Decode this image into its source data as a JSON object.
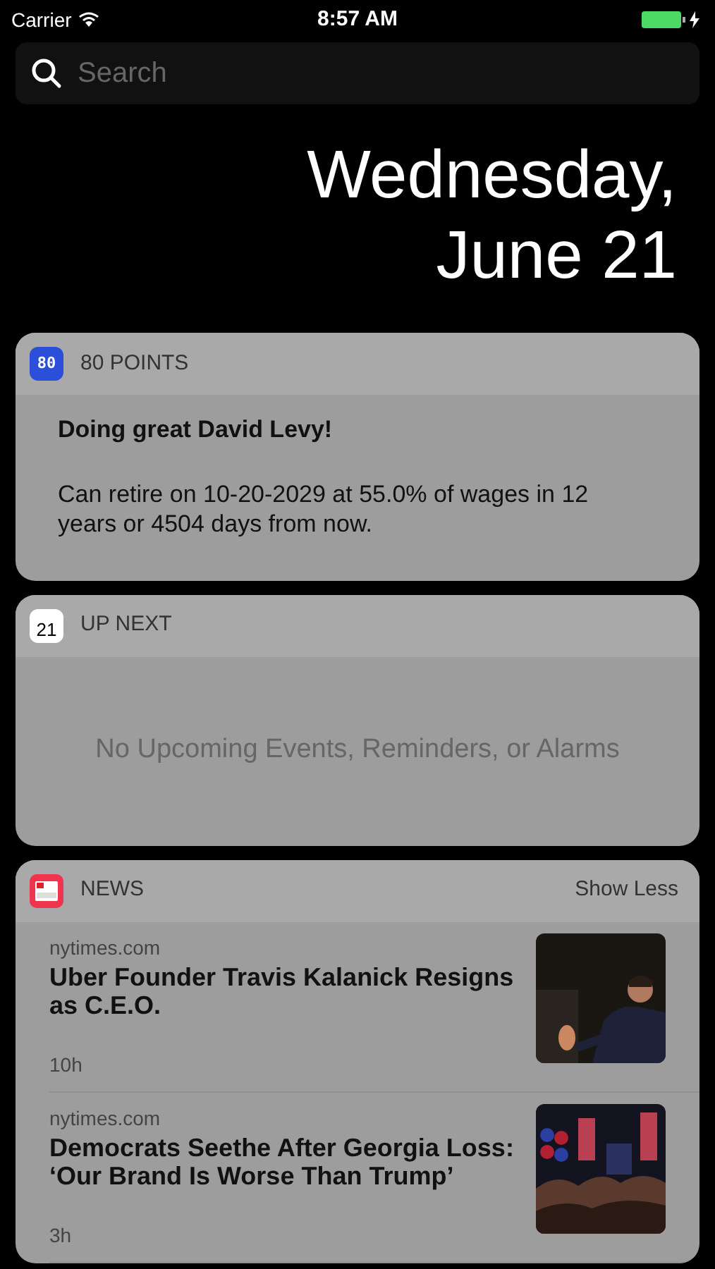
{
  "status_bar": {
    "carrier": "Carrier",
    "time": "8:57 AM"
  },
  "search": {
    "placeholder": "Search"
  },
  "date": {
    "line_1": "Wednesday,",
    "line_2": "June 21"
  },
  "widgets": [
    {
      "kind": "points",
      "app_icon_text": "80",
      "title": "80 POINTS",
      "heading": "Doing great David Levy!",
      "body": "Can retire on 10-20-2029 at 55.0% of wages in 12 years or 4504 days from now."
    },
    {
      "kind": "calendar",
      "app_icon_text": "21",
      "title": "UP NEXT",
      "empty_message": "No Upcoming Events, Reminders, or Alarms"
    },
    {
      "kind": "news",
      "title": "NEWS",
      "action": "Show Less",
      "stories": [
        {
          "source": "nytimes.com",
          "headline": "Uber Founder Travis Kalanick Resigns as C.E.O.",
          "age": "10h"
        },
        {
          "source": "nytimes.com",
          "headline": "Democrats Seethe After Georgia Loss: ‘Our Brand Is Worse Than Trump’",
          "age": "3h"
        }
      ]
    }
  ]
}
